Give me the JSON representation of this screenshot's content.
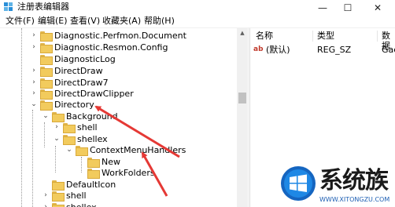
{
  "window": {
    "title": "注册表编辑器",
    "controls": {
      "minimize": "—",
      "maximize": "☐",
      "close": "✕"
    }
  },
  "menu": [
    {
      "label": "文件(F)"
    },
    {
      "label": "编辑(E)"
    },
    {
      "label": "查看(V)"
    },
    {
      "label": "收藏夹(A)"
    },
    {
      "label": "帮助(H)"
    }
  ],
  "tree": {
    "items": [
      {
        "label": "Diagnostic.Perfmon.Document",
        "expander": "›"
      },
      {
        "label": "Diagnostic.Resmon.Config",
        "expander": "›"
      },
      {
        "label": "DiagnosticLog",
        "expander": ""
      },
      {
        "label": "DirectDraw",
        "expander": "›"
      },
      {
        "label": "DirectDraw7",
        "expander": "›"
      },
      {
        "label": "DirectDrawClipper",
        "expander": "›"
      },
      {
        "label": "Directory",
        "expander": "⌄"
      },
      {
        "label": "Background",
        "expander": "⌄"
      },
      {
        "label": "shell",
        "expander": "›"
      },
      {
        "label": "shellex",
        "expander": "⌄"
      },
      {
        "label": "ContextMenuHandlers",
        "expander": "⌄"
      },
      {
        "label": "New",
        "expander": ""
      },
      {
        "label": "WorkFolders",
        "expander": ""
      },
      {
        "label": "DefaultIcon",
        "expander": ""
      },
      {
        "label": "shell",
        "expander": "›"
      },
      {
        "label": "shellex",
        "expander": "›"
      }
    ]
  },
  "list": {
    "columns": [
      {
        "label": "名称"
      },
      {
        "label": "类型"
      },
      {
        "label": "数据"
      }
    ],
    "rows": [
      {
        "name": "(默认)",
        "type": "REG_SZ",
        "data": "Gac",
        "icon": "ab-string-icon"
      }
    ]
  },
  "watermark": {
    "text": "系统族",
    "url": "WWW.XITONGZU.COM"
  },
  "colors": {
    "folder": "#f2cb5d",
    "arrow": "#e53935",
    "accent": "#0078d7"
  }
}
